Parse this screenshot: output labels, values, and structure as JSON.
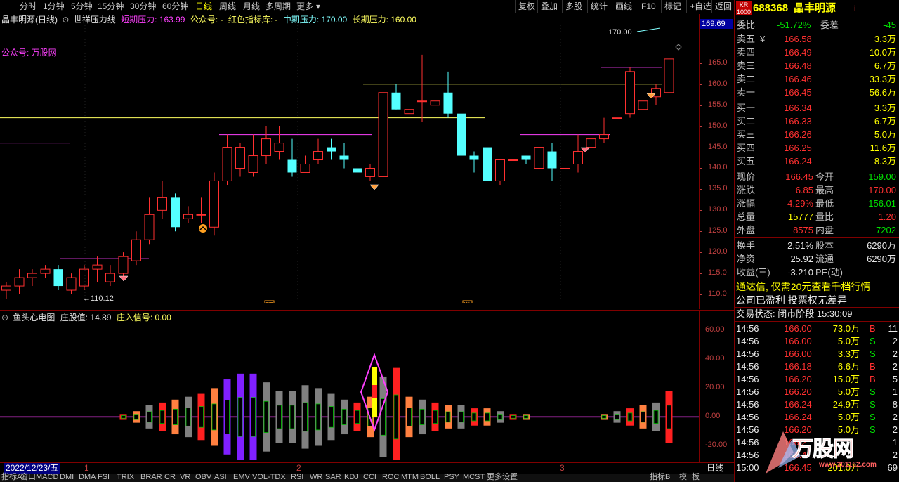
{
  "periods": [
    "分时",
    "1分钟",
    "5分钟",
    "15分钟",
    "30分钟",
    "60分钟",
    "日线",
    "周线",
    "月线",
    "多周期",
    "更多"
  ],
  "period_active": "日线",
  "right_tools": [
    "复权",
    "叠加",
    "多股",
    "统计",
    "画线",
    "F10",
    "标记",
    "+自选",
    "返回"
  ],
  "main_header": {
    "stock": "晶丰明源(日线)",
    "ind": "世祥压力线",
    "short_label": "短期压力: 163.99",
    "gzh_label": "公众号: -",
    "red_label": "红色指标库: -",
    "mid_label": "中期压力: 170.00",
    "long_label": "长期压力: 160.00"
  },
  "watermark_text": "公众号: 万股网",
  "price_ticks": [
    "165.0",
    "160.0",
    "155.0",
    "150.0",
    "145.0",
    "140.0",
    "135.0",
    "130.0",
    "125.0",
    "120.0",
    "115.0",
    "110.0"
  ],
  "current_price_tag": "169.69",
  "high_label": "170.00",
  "low_label": "←110.12",
  "marks": {
    "yu": "预",
    "ji": "激"
  },
  "sub_header": {
    "name": "鱼头心电图",
    "zg": "庄股值: 14.89",
    "zr": "庄入信号: 0.00"
  },
  "sub_ticks": [
    "60.00",
    "40.00",
    "20.00",
    "0.00",
    "-20.00"
  ],
  "date_label": "2022/12/23/五",
  "month_marks": [
    "1",
    "2",
    "3"
  ],
  "daily_tab": "日线",
  "bottom_tabs": [
    "指标A",
    "窗口",
    "MACD",
    "DMI",
    "DMA",
    "FSI",
    "TRIX",
    "BRAR",
    "CR",
    "VR",
    "OBV",
    "ASI",
    "EMV",
    "VOL-TDX",
    "RSI",
    "WR",
    "SAR",
    "KDJ",
    "CCI",
    "ROC",
    "MTM",
    "BOLL",
    "PSY",
    "MCST",
    "更多",
    "设置"
  ],
  "bottom_right_tabs": [
    "指标B",
    "模",
    "板"
  ],
  "quote": {
    "kr": "KR",
    "kr_sub": "1000",
    "code": "688368",
    "name": "晶丰明源",
    "info": "i",
    "wb_label": "委比",
    "wb": "-51.72%",
    "wc_label": "委差",
    "wc": "-45",
    "sells": [
      {
        "l": "卖五",
        "y": "¥",
        "p": "166.58",
        "v": "3.3万"
      },
      {
        "l": "卖四",
        "y": "",
        "p": "166.49",
        "v": "10.0万"
      },
      {
        "l": "卖三",
        "y": "",
        "p": "166.48",
        "v": "6.7万"
      },
      {
        "l": "卖二",
        "y": "",
        "p": "166.46",
        "v": "33.3万"
      },
      {
        "l": "卖一",
        "y": "",
        "p": "166.45",
        "v": "56.6万"
      }
    ],
    "buys": [
      {
        "l": "买一",
        "p": "166.34",
        "v": "3.3万"
      },
      {
        "l": "买二",
        "p": "166.33",
        "v": "6.7万"
      },
      {
        "l": "买三",
        "p": "166.26",
        "v": "5.0万"
      },
      {
        "l": "买四",
        "p": "166.25",
        "v": "11.6万"
      },
      {
        "l": "买五",
        "p": "166.24",
        "v": "8.3万"
      }
    ],
    "stats": [
      {
        "l1": "现价",
        "v1": "166.45",
        "c1": "red",
        "l2": "今开",
        "v2": "159.00",
        "c2": "green"
      },
      {
        "l1": "涨跌",
        "v1": "6.85",
        "c1": "red",
        "l2": "最高",
        "v2": "170.00",
        "c2": "red"
      },
      {
        "l1": "涨幅",
        "v1": "4.29%",
        "c1": "red",
        "l2": "最低",
        "v2": "156.01",
        "c2": "green"
      },
      {
        "l1": "总量",
        "v1": "15777",
        "c1": "yel",
        "l2": "量比",
        "v2": "1.20",
        "c2": "red"
      },
      {
        "l1": "外盘",
        "v1": "8575",
        "c1": "red",
        "l2": "内盘",
        "v2": "7202",
        "c2": "green"
      }
    ],
    "stats2": [
      {
        "l1": "换手",
        "v1": "2.51%",
        "l2": "股本",
        "v2": "6290万"
      },
      {
        "l1": "净资",
        "v1": "25.92",
        "l2": "流通",
        "v2": "6290万"
      },
      {
        "l1": "收益(三)",
        "v1": "-3.210",
        "l2": "PE(动)",
        "v2": ""
      }
    ],
    "ad": "通达信, 仅需20元查看千档行情",
    "notice": "公司已盈利 投票权无差异",
    "status": "交易状态: 闭市阶段 15:30:09"
  },
  "ticks": [
    {
      "t": "14:56",
      "p": "166.00",
      "v": "73.0万",
      "s": "B",
      "n": "11"
    },
    {
      "t": "14:56",
      "p": "166.00",
      "v": "5.0万",
      "s": "S",
      "n": "2"
    },
    {
      "t": "14:56",
      "p": "166.00",
      "v": "3.3万",
      "s": "S",
      "n": "2"
    },
    {
      "t": "14:56",
      "p": "166.18",
      "v": "6.6万",
      "s": "B",
      "n": "2"
    },
    {
      "t": "14:56",
      "p": "166.20",
      "v": "15.0万",
      "s": "B",
      "n": "5"
    },
    {
      "t": "14:56",
      "p": "166.20",
      "v": "5.0万",
      "s": "S",
      "n": "1"
    },
    {
      "t": "14:56",
      "p": "166.24",
      "v": "24.9万",
      "s": "S",
      "n": "8"
    },
    {
      "t": "14:56",
      "p": "166.24",
      "v": "5.0万",
      "s": "S",
      "n": "2"
    },
    {
      "t": "14:56",
      "p": "166.20",
      "v": "5.0万",
      "s": "S",
      "n": "2"
    },
    {
      "t": "14:56",
      "p": "166.2",
      "v": "",
      "s": "",
      "n": "1"
    },
    {
      "t": "14:56",
      "p": "166.4",
      "v": "",
      "s": "",
      "n": "2"
    },
    {
      "t": "15:00",
      "p": "166.45",
      "v": "201.0万",
      "s": "",
      "n": "69"
    }
  ],
  "logo_text": "万股网",
  "logo_url": "www.201162.com",
  "colors": {
    "up": "#ff3030",
    "down": "#54ffff",
    "yellow": "#ffff60",
    "magenta": "#ff40ff",
    "cyan": "#80ffff"
  },
  "chart_data": [
    {
      "type": "candlestick",
      "title": "晶丰明源(日线)",
      "ylim": [
        108,
        174
      ],
      "candles": [
        [
          111,
          112,
          109,
          113
        ],
        [
          112,
          114,
          110,
          116
        ],
        [
          114,
          115,
          112,
          116
        ],
        [
          115,
          116,
          114,
          117
        ],
        [
          116,
          112,
          111,
          117
        ],
        [
          111,
          114,
          110,
          115
        ],
        [
          112,
          116,
          111,
          117
        ],
        [
          116,
          117,
          113,
          119
        ],
        [
          113,
          115,
          112,
          117
        ],
        [
          115,
          119,
          114,
          120
        ],
        [
          118,
          123,
          117,
          125
        ],
        [
          123,
          129,
          122,
          133
        ],
        [
          130,
          133,
          128,
          137
        ],
        [
          133,
          126,
          125,
          134
        ],
        [
          128,
          129,
          127,
          131
        ],
        [
          129,
          129,
          127,
          133
        ],
        [
          126,
          137,
          124,
          139
        ],
        [
          137,
          145,
          136,
          148
        ],
        [
          140,
          145,
          138,
          146
        ],
        [
          139,
          143,
          138,
          148
        ],
        [
          143,
          147,
          141,
          150
        ],
        [
          144,
          146,
          142,
          150
        ],
        [
          142,
          139,
          138,
          147
        ],
        [
          139,
          141,
          139,
          143
        ],
        [
          142,
          144,
          141,
          147
        ],
        [
          145,
          144,
          142,
          147
        ],
        [
          143,
          142,
          140,
          146
        ],
        [
          140,
          139,
          139,
          141
        ],
        [
          138,
          140,
          137,
          141
        ],
        [
          138,
          158,
          137,
          160
        ],
        [
          158,
          154,
          154,
          160
        ],
        [
          153,
          154,
          152,
          159
        ],
        [
          156,
          156,
          151,
          167
        ],
        [
          155,
          156,
          149,
          158
        ],
        [
          158,
          153,
          152,
          163
        ],
        [
          153,
          143,
          140,
          156
        ],
        [
          143,
          142,
          139,
          144
        ],
        [
          145,
          137,
          134,
          146
        ],
        [
          137,
          142,
          136,
          142
        ],
        [
          142,
          142,
          141,
          143
        ],
        [
          143,
          142,
          141,
          143
        ],
        [
          140,
          145,
          139,
          147
        ],
        [
          144,
          140,
          137,
          146
        ],
        [
          140,
          140,
          138,
          145
        ],
        [
          141,
          144,
          139,
          148
        ],
        [
          145,
          147,
          144,
          151
        ],
        [
          147,
          148,
          146,
          152
        ],
        [
          152,
          152,
          151,
          155
        ],
        [
          153,
          163,
          152,
          164
        ],
        [
          154,
          156,
          153,
          157
        ],
        [
          157,
          159,
          155,
          160
        ],
        [
          158,
          166,
          157,
          170
        ]
      ],
      "pressure_lines": [
        {
          "name": "短期压力",
          "value": 163.99,
          "color": "#ff40ff"
        },
        {
          "name": "中期压力",
          "value": 170.0,
          "color": "#80ffff"
        },
        {
          "name": "长期压力",
          "value": 160.0,
          "color": "#ffff60"
        }
      ]
    },
    {
      "type": "bar",
      "title": "鱼头心电图",
      "ylim": [
        -30,
        65
      ],
      "values": [
        0,
        0,
        0,
        0,
        0,
        0,
        0,
        0,
        0,
        2,
        4,
        8,
        10,
        12,
        14,
        16,
        20,
        26,
        30,
        30,
        24,
        18,
        18,
        22,
        20,
        16,
        12,
        10,
        14,
        28,
        34,
        14,
        12,
        10,
        8,
        8,
        6,
        6,
        4,
        2,
        2,
        0,
        0,
        0,
        0,
        0,
        2,
        4,
        6,
        8,
        10,
        18
      ]
    }
  ]
}
